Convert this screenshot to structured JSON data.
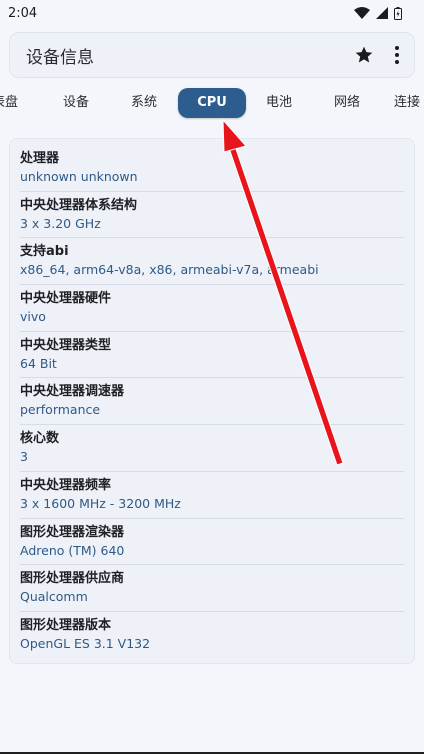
{
  "status": {
    "time": "2:04"
  },
  "app": {
    "title": "设备信息"
  },
  "tabs": [
    {
      "label": "表盘"
    },
    {
      "label": "设备"
    },
    {
      "label": "系统"
    },
    {
      "label": "CPU"
    },
    {
      "label": "电池"
    },
    {
      "label": "网络"
    },
    {
      "label": "连接"
    }
  ],
  "cpu_info": [
    {
      "label": "处理器",
      "value": "unknown unknown"
    },
    {
      "label": "中央处理器体系结构",
      "value": "3 x 3.20 GHz"
    },
    {
      "label": "支持abi",
      "value": "x86_64, arm64-v8a, x86, armeabi-v7a, armeabi"
    },
    {
      "label": "中央处理器硬件",
      "value": "vivo"
    },
    {
      "label": "中央处理器类型",
      "value": "64 Bit"
    },
    {
      "label": "中央处理器调速器",
      "value": "performance"
    },
    {
      "label": "核心数",
      "value": "3"
    },
    {
      "label": "中央处理器频率",
      "value": "3 x 1600 MHz - 3200 MHz"
    },
    {
      "label": "图形处理器渲染器",
      "value": "Adreno (TM) 640"
    },
    {
      "label": "图形处理器供应商",
      "value": "Qualcomm"
    },
    {
      "label": "图形处理器版本",
      "value": "OpenGL ES 3.1 V132"
    }
  ],
  "colors": {
    "accent": "#2d5d8f",
    "value_text": "#2f5a86",
    "arrow": "#e8141c"
  }
}
